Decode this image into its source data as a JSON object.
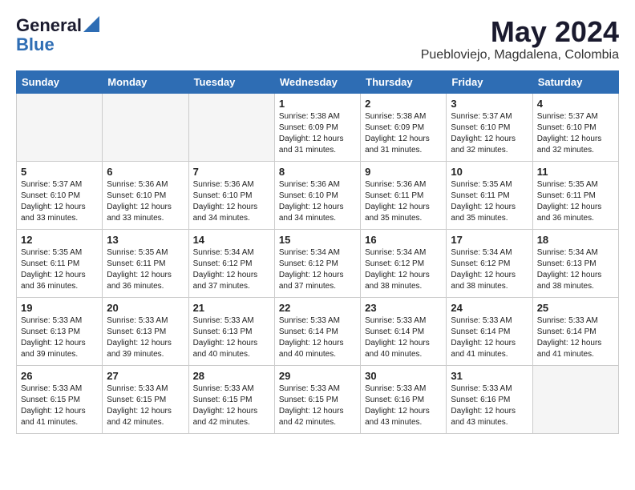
{
  "logo": {
    "general": "General",
    "blue": "Blue"
  },
  "title": "May 2024",
  "location": "Puebloviejo, Magdalena, Colombia",
  "days_header": [
    "Sunday",
    "Monday",
    "Tuesday",
    "Wednesday",
    "Thursday",
    "Friday",
    "Saturday"
  ],
  "weeks": [
    [
      {
        "day": "",
        "info": ""
      },
      {
        "day": "",
        "info": ""
      },
      {
        "day": "",
        "info": ""
      },
      {
        "day": "1",
        "info": "Sunrise: 5:38 AM\nSunset: 6:09 PM\nDaylight: 12 hours\nand 31 minutes."
      },
      {
        "day": "2",
        "info": "Sunrise: 5:38 AM\nSunset: 6:09 PM\nDaylight: 12 hours\nand 31 minutes."
      },
      {
        "day": "3",
        "info": "Sunrise: 5:37 AM\nSunset: 6:10 PM\nDaylight: 12 hours\nand 32 minutes."
      },
      {
        "day": "4",
        "info": "Sunrise: 5:37 AM\nSunset: 6:10 PM\nDaylight: 12 hours\nand 32 minutes."
      }
    ],
    [
      {
        "day": "5",
        "info": "Sunrise: 5:37 AM\nSunset: 6:10 PM\nDaylight: 12 hours\nand 33 minutes."
      },
      {
        "day": "6",
        "info": "Sunrise: 5:36 AM\nSunset: 6:10 PM\nDaylight: 12 hours\nand 33 minutes."
      },
      {
        "day": "7",
        "info": "Sunrise: 5:36 AM\nSunset: 6:10 PM\nDaylight: 12 hours\nand 34 minutes."
      },
      {
        "day": "8",
        "info": "Sunrise: 5:36 AM\nSunset: 6:10 PM\nDaylight: 12 hours\nand 34 minutes."
      },
      {
        "day": "9",
        "info": "Sunrise: 5:36 AM\nSunset: 6:11 PM\nDaylight: 12 hours\nand 35 minutes."
      },
      {
        "day": "10",
        "info": "Sunrise: 5:35 AM\nSunset: 6:11 PM\nDaylight: 12 hours\nand 35 minutes."
      },
      {
        "day": "11",
        "info": "Sunrise: 5:35 AM\nSunset: 6:11 PM\nDaylight: 12 hours\nand 36 minutes."
      }
    ],
    [
      {
        "day": "12",
        "info": "Sunrise: 5:35 AM\nSunset: 6:11 PM\nDaylight: 12 hours\nand 36 minutes."
      },
      {
        "day": "13",
        "info": "Sunrise: 5:35 AM\nSunset: 6:11 PM\nDaylight: 12 hours\nand 36 minutes."
      },
      {
        "day": "14",
        "info": "Sunrise: 5:34 AM\nSunset: 6:12 PM\nDaylight: 12 hours\nand 37 minutes."
      },
      {
        "day": "15",
        "info": "Sunrise: 5:34 AM\nSunset: 6:12 PM\nDaylight: 12 hours\nand 37 minutes."
      },
      {
        "day": "16",
        "info": "Sunrise: 5:34 AM\nSunset: 6:12 PM\nDaylight: 12 hours\nand 38 minutes."
      },
      {
        "day": "17",
        "info": "Sunrise: 5:34 AM\nSunset: 6:12 PM\nDaylight: 12 hours\nand 38 minutes."
      },
      {
        "day": "18",
        "info": "Sunrise: 5:34 AM\nSunset: 6:13 PM\nDaylight: 12 hours\nand 38 minutes."
      }
    ],
    [
      {
        "day": "19",
        "info": "Sunrise: 5:33 AM\nSunset: 6:13 PM\nDaylight: 12 hours\nand 39 minutes."
      },
      {
        "day": "20",
        "info": "Sunrise: 5:33 AM\nSunset: 6:13 PM\nDaylight: 12 hours\nand 39 minutes."
      },
      {
        "day": "21",
        "info": "Sunrise: 5:33 AM\nSunset: 6:13 PM\nDaylight: 12 hours\nand 40 minutes."
      },
      {
        "day": "22",
        "info": "Sunrise: 5:33 AM\nSunset: 6:14 PM\nDaylight: 12 hours\nand 40 minutes."
      },
      {
        "day": "23",
        "info": "Sunrise: 5:33 AM\nSunset: 6:14 PM\nDaylight: 12 hours\nand 40 minutes."
      },
      {
        "day": "24",
        "info": "Sunrise: 5:33 AM\nSunset: 6:14 PM\nDaylight: 12 hours\nand 41 minutes."
      },
      {
        "day": "25",
        "info": "Sunrise: 5:33 AM\nSunset: 6:14 PM\nDaylight: 12 hours\nand 41 minutes."
      }
    ],
    [
      {
        "day": "26",
        "info": "Sunrise: 5:33 AM\nSunset: 6:15 PM\nDaylight: 12 hours\nand 41 minutes."
      },
      {
        "day": "27",
        "info": "Sunrise: 5:33 AM\nSunset: 6:15 PM\nDaylight: 12 hours\nand 42 minutes."
      },
      {
        "day": "28",
        "info": "Sunrise: 5:33 AM\nSunset: 6:15 PM\nDaylight: 12 hours\nand 42 minutes."
      },
      {
        "day": "29",
        "info": "Sunrise: 5:33 AM\nSunset: 6:15 PM\nDaylight: 12 hours\nand 42 minutes."
      },
      {
        "day": "30",
        "info": "Sunrise: 5:33 AM\nSunset: 6:16 PM\nDaylight: 12 hours\nand 43 minutes."
      },
      {
        "day": "31",
        "info": "Sunrise: 5:33 AM\nSunset: 6:16 PM\nDaylight: 12 hours\nand 43 minutes."
      },
      {
        "day": "",
        "info": ""
      }
    ]
  ]
}
